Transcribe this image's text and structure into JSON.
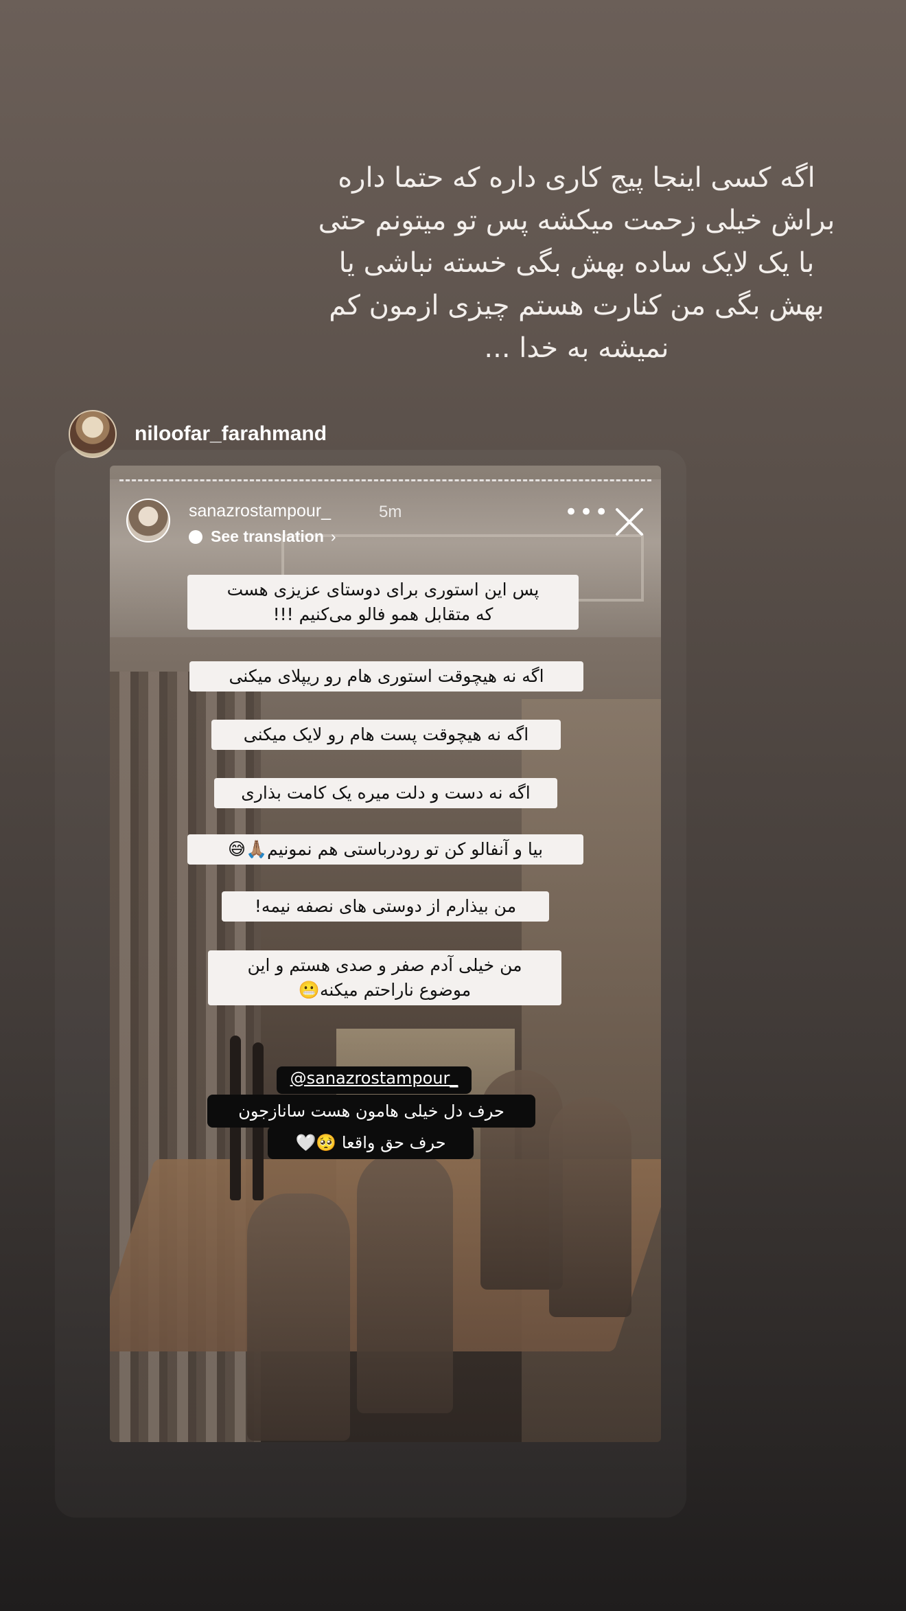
{
  "caption": "اگه کسی اینجا پیج کاری داره که حتما داره\nبراش خیلی زحمت میکشه پس تو میتونم حتی\nبا یک لایک ساده بهش بگی خسته نباشی یا\nبهش بگی من کنارت هستم چیزی ازمون کم\nنمیشه به خدا ...",
  "share": {
    "username": "niloofar_farahmand"
  },
  "story": {
    "username": "sanazrostampour_",
    "time": "5m",
    "translation_label": "See translation",
    "more_label": "•••",
    "texts": [
      "پس این استوری برای دوستای عزیزی هست\nکه متقابل همو فالو می‌کنیم !!!",
      "اگه نه هیچوقت استوری هام رو ریپلای میکنی",
      "اگه نه هیچوقت پست هام رو لایک میکنی",
      "اگه نه دست و دلت میره یک کامت بذاری",
      "بیا و آنفالو کن تو رودرباستی هم نمونیم🙏🏽😅",
      "من بیذارم از دوستی های نصفه نیمه!",
      "من خیلی آدم صفر و صدی هستم و این\nموضوع ناراحتم میکنه😬"
    ],
    "mention": "@sanazrostampour_",
    "reply_line1": "حرف دل خیلی هامون هست ساناز‌جون",
    "reply_line2": "حرف حق واقعا 🥺🤍"
  }
}
